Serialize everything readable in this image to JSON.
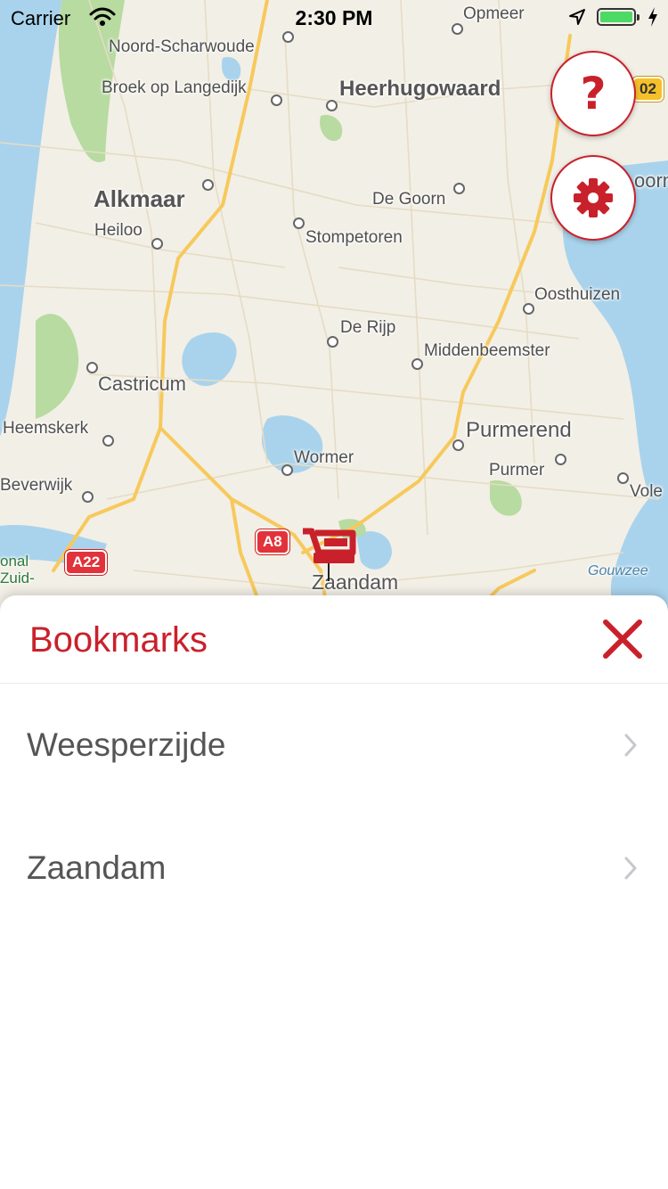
{
  "status_bar": {
    "carrier": "Carrier",
    "time": "2:30 PM",
    "battery_level": 1.0,
    "icons": [
      "wifi-icon",
      "location-arrow-icon",
      "battery-icon",
      "charging-bolt-icon"
    ]
  },
  "map": {
    "places": [
      {
        "name": "Opmeer",
        "kind": "minor"
      },
      {
        "name": "Noord-Scharwoude",
        "kind": "minor"
      },
      {
        "name": "Broek op Langedijk",
        "kind": "minor"
      },
      {
        "name": "Heerhugowaard",
        "kind": "major"
      },
      {
        "name": "Alkmaar",
        "kind": "major"
      },
      {
        "name": "De Goorn",
        "kind": "minor"
      },
      {
        "name": "Heiloo",
        "kind": "minor"
      },
      {
        "name": "Stompetoren",
        "kind": "minor"
      },
      {
        "name": "Oosthuizen",
        "kind": "minor"
      },
      {
        "name": "De Rijp",
        "kind": "minor"
      },
      {
        "name": "Middenbeemster",
        "kind": "minor"
      },
      {
        "name": "Castricum",
        "kind": "major-small"
      },
      {
        "name": "Heemskerk",
        "kind": "minor"
      },
      {
        "name": "Purmerend",
        "kind": "major-small"
      },
      {
        "name": "Wormer",
        "kind": "minor"
      },
      {
        "name": "Purmer",
        "kind": "minor"
      },
      {
        "name": "Beverwijk",
        "kind": "minor"
      },
      {
        "name": "Vole",
        "kind": "minor"
      },
      {
        "name": "Zaandam",
        "kind": "major-small"
      },
      {
        "name": "Gouwzee",
        "kind": "water"
      },
      {
        "name": "oorn",
        "kind": "major-small"
      },
      {
        "name": "onal Zuid-",
        "kind": "park"
      }
    ],
    "road_shields": [
      {
        "label": "A8",
        "color": "#e2323a"
      },
      {
        "label": "A22",
        "color": "#e2323a"
      },
      {
        "label": "02",
        "color": "#f5c02a"
      }
    ],
    "pin": {
      "icon": "shopping-cart-pin-icon",
      "color": "#c9212b"
    }
  },
  "buttons": {
    "help": {
      "label": "?",
      "icon": "question-mark-icon"
    },
    "settings": {
      "icon": "gear-icon"
    }
  },
  "bookmarks": {
    "title": "Bookmarks",
    "close_icon": "close-icon",
    "items": [
      {
        "label": "Weesperzijde"
      },
      {
        "label": "Zaandam"
      }
    ]
  },
  "colors": {
    "accent": "#c9212b",
    "map_land": "#f2efe6",
    "map_water": "#a9d3ec",
    "map_green": "#b7dba0",
    "road_major": "#f7c95c"
  }
}
